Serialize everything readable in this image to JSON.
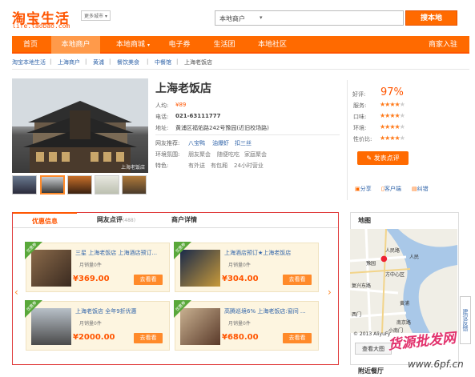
{
  "header": {
    "logo": "淘宝生活",
    "logo_sub": "life.taobao.com",
    "more_label": "更多城市",
    "search_scope": "本地商户",
    "search_btn": "搜本地"
  },
  "nav": {
    "items": [
      "首页",
      "本地商户",
      "本地商城",
      "电子券",
      "生活团",
      "本地社区"
    ],
    "active_index": 1,
    "merchant_entry": "商家入驻"
  },
  "breadcrumb": [
    "淘宝本地生活",
    "上海商户",
    "黄浦",
    "餐饮美食",
    "中餐馆",
    "上海老饭店"
  ],
  "store": {
    "name": "上海老饭店",
    "avg_label": "人均:",
    "avg_value": "¥89",
    "phone_label": "电话:",
    "phone": "021-63111777",
    "address_label": "地址:",
    "address": "黄浦区福佑路242号豫园(近旧校场路)",
    "recommend_label": "网友推荐:",
    "recommend": [
      "八宝鸭",
      "油爆虾",
      "扣三丝"
    ],
    "env_label": "环境氛围:",
    "env": [
      "朋友聚会",
      "随便吃吃",
      "家庭聚会"
    ],
    "feature_label": "特色:",
    "features": [
      "有外送",
      "有包厢",
      "24小时营业"
    ],
    "photo_caption": "上海老饭店"
  },
  "rating": {
    "good_label": "好评:",
    "good_pct": "97%",
    "items": [
      {
        "label": "服务:",
        "stars": 4
      },
      {
        "label": "口味:",
        "stars": 4
      },
      {
        "label": "环境:",
        "stars": 4
      },
      {
        "label": "性价比:",
        "stars": 4
      }
    ],
    "review_btn": "发表点评",
    "share": "分享",
    "client": "客户端",
    "correct": "纠错"
  },
  "tabs": {
    "items": [
      "优惠信息",
      "网友点评",
      "商户详情"
    ],
    "review_count": "(488)",
    "active_index": 0
  },
  "deals": [
    {
      "badge": "优惠券",
      "title": "三星 上海老饭店 上海酒店预订...",
      "sold": "月销量0件",
      "price": "¥369.00",
      "btn": "去看看"
    },
    {
      "badge": "优惠券",
      "title": "上海酒店预订★上海老饭店",
      "sold": "月销量0件",
      "price": "¥304.00",
      "btn": "去看看"
    },
    {
      "badge": "优惠券",
      "title": "上海老饭店 全年9折优惠",
      "sold": "月销量0件",
      "price": "¥2000.00",
      "btn": "去看看"
    },
    {
      "badge": "优惠券",
      "title": "高腾巡境6% 上海老饭店:窗间 ...",
      "sold": "月销量0件",
      "price": "¥680.00",
      "btn": "去看看"
    }
  ],
  "map": {
    "title": "地图",
    "labels": [
      "人民路",
      "豫园",
      "方中心区",
      "南京路",
      "西门",
      "小南门",
      "黄浦",
      "复兴东路",
      "人民"
    ],
    "copyright": "© 2013 AliyuFy",
    "view_large": "查看大图",
    "nearby": "附近餐厅"
  },
  "side_tab": "建议反馈",
  "watermark": "货源批发网",
  "watermark2": "www.6pf.cn",
  "colors": {
    "brand": "#ff6a00",
    "link": "#3366aa",
    "price": "#ff5500",
    "highlight": "#e03c3c"
  }
}
